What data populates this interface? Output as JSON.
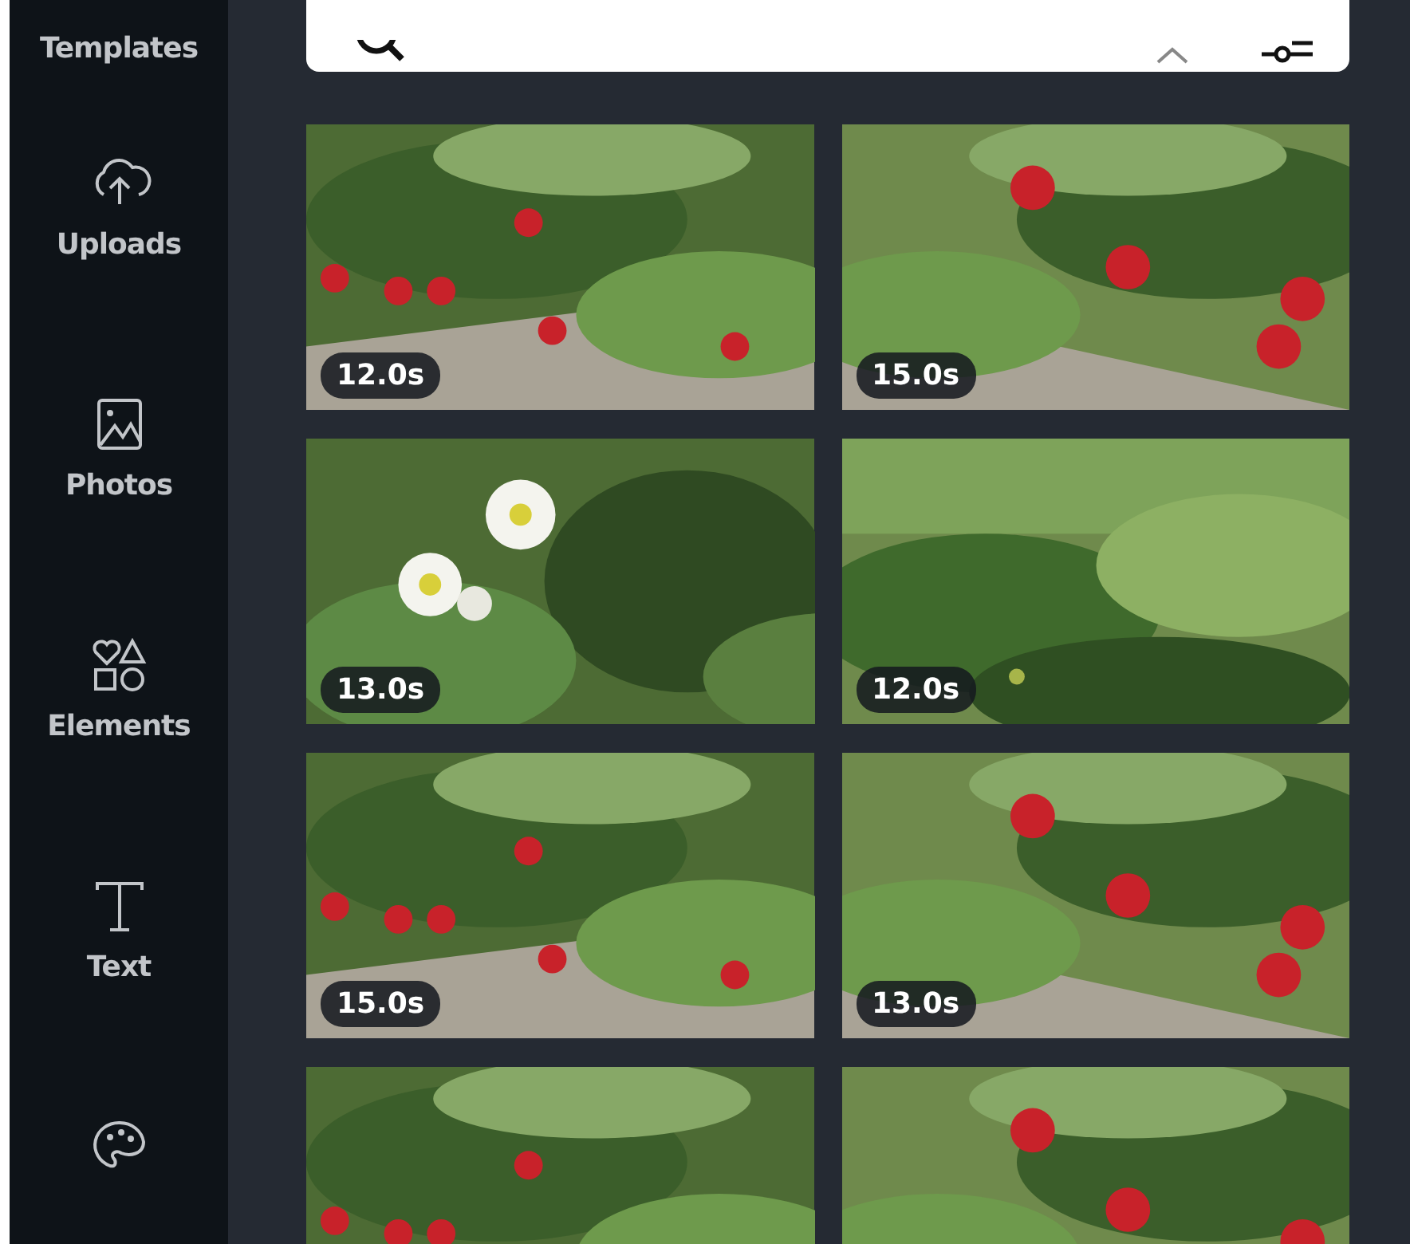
{
  "sidebar": {
    "items": [
      {
        "label": "Templates"
      },
      {
        "label": "Uploads"
      },
      {
        "label": "Photos"
      },
      {
        "label": "Elements"
      },
      {
        "label": "Text"
      }
    ]
  },
  "videos": [
    {
      "duration": "12.0s",
      "kind": "picture"
    },
    {
      "duration": "15.0s",
      "kind": "picture"
    },
    {
      "duration": "13.0s",
      "kind": "picture"
    },
    {
      "duration": "12.0s",
      "kind": "picture"
    },
    {
      "duration": "15.0s",
      "kind": "picture"
    },
    {
      "duration": "13.0s",
      "kind": "picture"
    },
    {
      "kind": "picture"
    },
    {
      "kind": "picture"
    }
  ]
}
